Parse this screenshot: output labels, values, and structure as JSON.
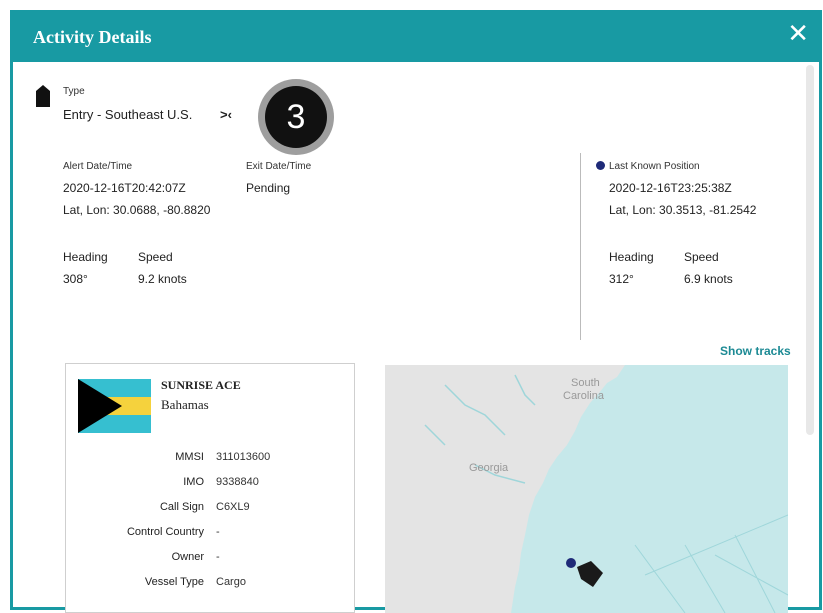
{
  "modal": {
    "title": "Activity Details",
    "close_label": "✕"
  },
  "activity": {
    "type_label": "Type",
    "type_value": "Entry - Southeast U.S.",
    "type_arrows": ">‹",
    "badge_number": "3"
  },
  "alert": {
    "alert_label": "Alert Date/Time",
    "alert_value": "2020-12-16T20:42:07Z",
    "exit_label": "Exit Date/Time",
    "exit_value": "Pending",
    "latlon": "Lat, Lon: 30.0688, -80.8820",
    "heading_label": "Heading",
    "heading_value": "308°",
    "speed_label": "Speed",
    "speed_value": "9.2 knots"
  },
  "last_known": {
    "label": "Last Known Position",
    "datetime": "2020-12-16T23:25:38Z",
    "latlon": "Lat, Lon: 30.3513, -81.2542",
    "heading_label": "Heading",
    "heading_value": "312°",
    "speed_label": "Speed",
    "speed_value": "6.9 knots",
    "dot_color": "#1e2a78"
  },
  "show_tracks": "Show tracks",
  "vessel": {
    "name": "SUNRISE ACE",
    "flag_country": "Bahamas",
    "fields": [
      {
        "key": "MMSI",
        "value": "311013600"
      },
      {
        "key": "IMO",
        "value": "9338840"
      },
      {
        "key": "Call Sign",
        "value": "C6XL9"
      },
      {
        "key": "Control Country",
        "value": "-"
      },
      {
        "key": "Owner",
        "value": "-"
      },
      {
        "key": "Vessel Type",
        "value": "Cargo"
      }
    ]
  },
  "map": {
    "label_state_1": "South",
    "label_state_2": "Carolina",
    "label_georgia": "Georgia"
  },
  "colors": {
    "accent": "#189aa3",
    "link": "#1c8a94"
  }
}
